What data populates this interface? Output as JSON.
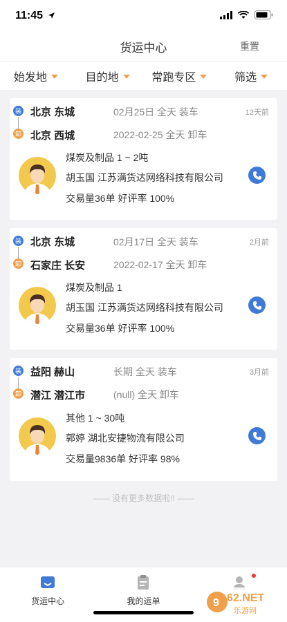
{
  "status": {
    "time": "11:45"
  },
  "header": {
    "title": "货运中心",
    "reset_label": "重置"
  },
  "filters": [
    {
      "label": "始发地"
    },
    {
      "label": "目的地"
    },
    {
      "label": "常跑专区"
    },
    {
      "label": "筛选"
    }
  ],
  "cards": [
    {
      "load_badge": "装",
      "unload_badge": "卸",
      "from_city": "北京 东城",
      "load_time": "02月25日 全天 装车",
      "age": "12天前",
      "to_city": "北京 西城",
      "unload_time": "2022-02-25 全天 卸车",
      "cargo": "煤炭及制品 1 ~ 2吨",
      "shipper": "胡玉国 江苏满货达网络科技有限公司",
      "stats": "交易量36单 好评率 100%"
    },
    {
      "load_badge": "装",
      "unload_badge": "卸",
      "from_city": "北京 东城",
      "load_time": "02月17日 全天 装车",
      "age": "2月前",
      "to_city": "石家庄 长安",
      "unload_time": "2022-02-17 全天 卸车",
      "cargo": "煤炭及制品  1",
      "shipper": "胡玉国 江苏满货达网络科技有限公司",
      "stats": "交易量36单 好评率 100%"
    },
    {
      "load_badge": "装",
      "unload_badge": "卸",
      "from_city": "益阳 赫山",
      "load_time": "长期 全天 装车",
      "age": "3月前",
      "to_city": "潜江 潜江市",
      "unload_time": "(null) 全天 卸车",
      "cargo": "其他 1 ~ 30吨",
      "shipper": "郭婷 湖北安捷物流有限公司",
      "stats": "交易量9836单 好评率 98%"
    }
  ],
  "no_more": "—— 没有更多数据啦!! ——",
  "tabs": [
    {
      "label": "货运中心",
      "icon": "truck-icon",
      "active": true
    },
    {
      "label": "我的运单",
      "icon": "clipboard-icon",
      "active": false
    },
    {
      "label": "",
      "icon": "user-icon",
      "active": false
    }
  ],
  "watermark": {
    "brand": "962.NET",
    "sub": "乐游网"
  },
  "colors": {
    "accent": "#3f7bd6",
    "orange": "#f0a04b",
    "background": "#f2f2f4"
  }
}
